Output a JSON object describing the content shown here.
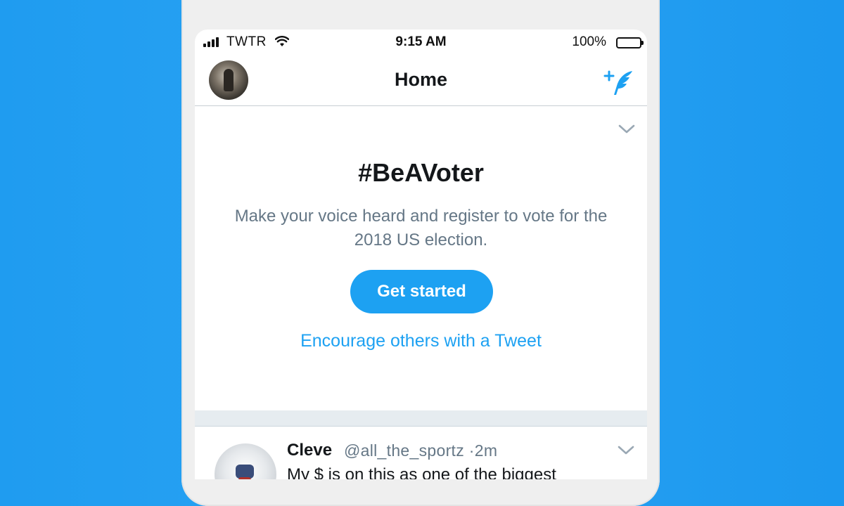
{
  "status_bar": {
    "carrier": "TWTR",
    "time": "9:15 AM",
    "battery_percent_text": "100%",
    "battery_level": 1.0
  },
  "nav": {
    "title": "Home",
    "compose_icon": "compose-tweet-icon",
    "avatar_icon": "profile-avatar"
  },
  "prompt_card": {
    "headline": "#BeAVoter",
    "description": "Make your voice heard and register to vote for the 2018 US election.",
    "cta_label": "Get started",
    "secondary_link": "Encourage others with a Tweet",
    "menu_icon": "chevron-down-icon"
  },
  "tweet": {
    "name": "Cleve",
    "handle": "@all_the_sportz",
    "separator": "·",
    "time": "2m",
    "text": "My $ is on this as one of the biggest"
  },
  "colors": {
    "background": "#1f9cf0",
    "accent": "#1da1f2",
    "text_primary": "#14171a",
    "text_secondary": "#657786"
  }
}
